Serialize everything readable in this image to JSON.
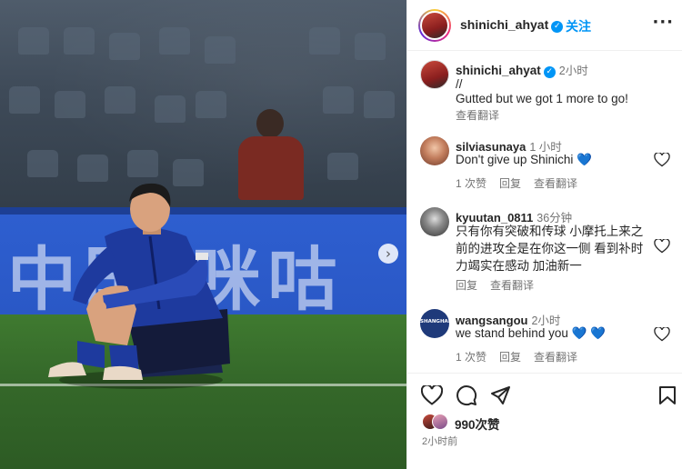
{
  "post": {
    "author": "shinichi_ahyat",
    "follow_label": "关注",
    "separator": "•",
    "more_label": "···",
    "photo": {
      "billboard_text": "中国 咪咕",
      "next_glyph": "›"
    },
    "caption": {
      "username": "shinichi_ahyat",
      "time": "2小时",
      "line1": "//",
      "line2": "Gutted but we got 1 more to go!",
      "translate": "查看翻译"
    },
    "comments": [
      {
        "username": "silviasunaya",
        "time": "1 小时",
        "text": "Don't give up Shinichi 💙",
        "likes": "1 次赞",
        "reply": "回复",
        "translate": "查看翻译"
      },
      {
        "username": "kyuutan_0811",
        "time": "36分钟",
        "text": "只有你有突破和传球 小摩托上来之前的进攻全是在你这一侧 看到补时力竭实在感动 加油新一",
        "reply": "回复",
        "translate": "查看翻译"
      },
      {
        "username": "wangsangou",
        "time": "2小时",
        "text": "we stand behind you 💙 💙",
        "likes": "1 次赞",
        "reply": "回复",
        "translate": "查看翻译",
        "avatar_text": "SHANGHAI"
      }
    ],
    "footer": {
      "likes": "990次赞",
      "posted": "2小时前"
    }
  },
  "colors": {
    "accent": "#0095f6",
    "text": "#262626",
    "muted": "#737373",
    "border": "#efefef"
  }
}
